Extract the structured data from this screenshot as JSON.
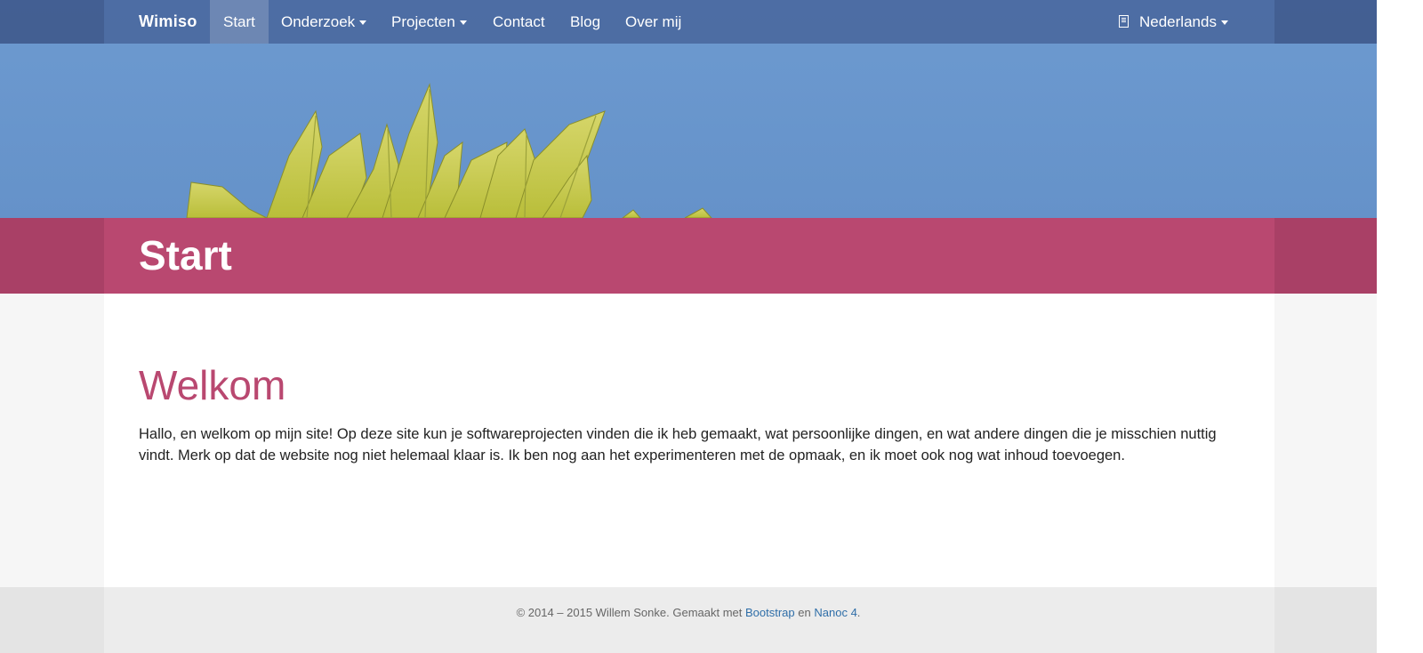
{
  "navbar": {
    "brand": "Wimiso",
    "items": [
      {
        "label": "Start",
        "active": true,
        "dropdown": false
      },
      {
        "label": "Onderzoek",
        "active": false,
        "dropdown": true
      },
      {
        "label": "Projecten",
        "active": false,
        "dropdown": true
      },
      {
        "label": "Contact",
        "active": false,
        "dropdown": false
      },
      {
        "label": "Blog",
        "active": false,
        "dropdown": false
      },
      {
        "label": "Over mij",
        "active": false,
        "dropdown": false
      }
    ],
    "language": {
      "label": "Nederlands",
      "icon": "book-icon"
    }
  },
  "header": {
    "title": "Start"
  },
  "main": {
    "heading": "Welkom",
    "paragraph": "Hallo, en welkom op mijn site! Op deze site kun je softwareprojecten vinden die ik heb gemaakt, wat persoonlijke dingen, en wat andere dingen die je misschien nuttig vindt. Merk op dat de website nog niet helemaal klaar is. Ik ben nog aan het experimenteren met de opmaak, en ik moet ook nog wat inhoud toevoegen."
  },
  "footer": {
    "copyright": "© 2014 – 2015  Willem Sonke. Gemaakt met",
    "link1": "Bootstrap",
    "conj": "en",
    "link2": "Nanoc 4",
    "end": "."
  },
  "colors": {
    "navbar": "#5272ad",
    "sky": "#6a97cd",
    "accent": "#b94870",
    "footer": "#ececec",
    "link": "#2f6ea8"
  }
}
